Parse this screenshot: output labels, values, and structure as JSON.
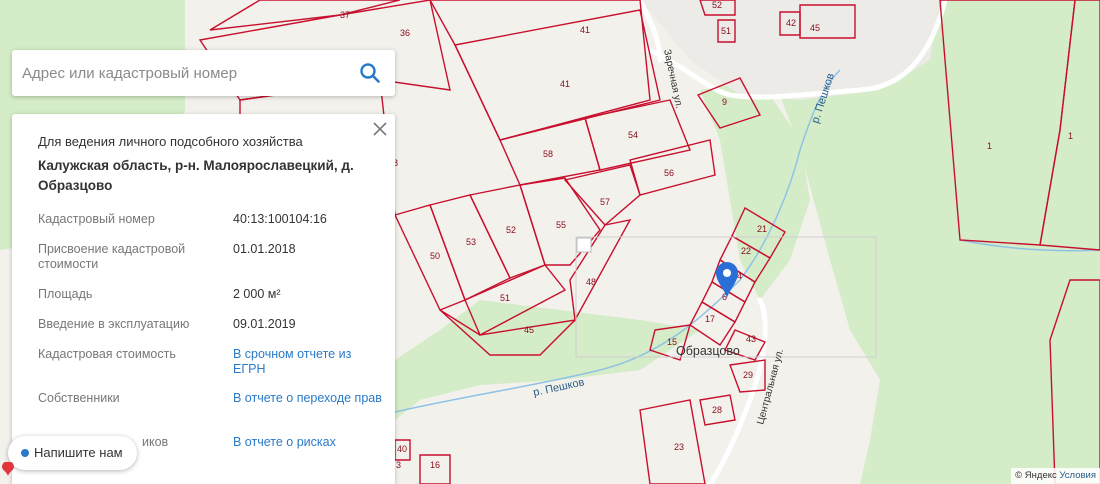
{
  "search": {
    "placeholder": "Адрес или кадастровый номер"
  },
  "card": {
    "category": "Для ведения личного подсобного хозяйства",
    "address": "Калужская область, р-н. Малоярославецкий, д. Образцово",
    "rows": [
      {
        "label": "Кадастровый номер",
        "value": "40:13:100104:16"
      },
      {
        "label": "Присвоение кадастровой стоимости",
        "value": "01.01.2018"
      },
      {
        "label": "Площадь",
        "value": "2 000 м²"
      },
      {
        "label": "Введение в эксплуатацию",
        "value": "09.01.2019"
      },
      {
        "label": "Кадастровая стоимость",
        "value": "В срочном отчете из ЕГРН"
      },
      {
        "label": "Собственники",
        "value": "В отчете о переходе прав"
      },
      {
        "label": "Обременения и риски",
        "label_visible": "иков",
        "value": "В отчете о рисках"
      }
    ]
  },
  "chat": {
    "label": "Напишите нам"
  },
  "map": {
    "village": "Образцово",
    "river_labels": [
      "р. Пешков",
      "р. Пешков"
    ],
    "streets": [
      "Заречная ул.",
      "Центральная ул."
    ],
    "plots": [
      "37",
      "36",
      "41",
      "41",
      "54",
      "58",
      "56",
      "57",
      "55",
      "52",
      "53",
      "50",
      "48",
      "51",
      "45",
      "8",
      "9",
      "52",
      "51",
      "42",
      "45",
      "21",
      "22",
      "4",
      "6",
      "17",
      "15",
      "43",
      "29",
      "28",
      "23",
      "1",
      "1",
      "40",
      "16",
      "3"
    ],
    "attribution_prefix": "© Яндекс",
    "attribution_link": "Условия"
  },
  "colors": {
    "plot_border": "#c8102e",
    "forest": "#d4ecc7",
    "water": "#8ec3e6",
    "link": "#2a7ac9",
    "marker": "#2a6fd6"
  },
  "icons": {
    "search": "search-icon",
    "close": "close-icon",
    "marker": "location-pin-icon",
    "chat": "chat-dot-icon"
  }
}
